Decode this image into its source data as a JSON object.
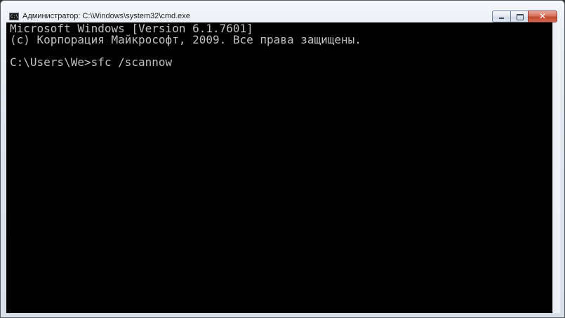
{
  "window": {
    "title": "Администратор: C:\\Windows\\system32\\cmd.exe",
    "icon": "cmd-icon",
    "icon_text": "C:\\"
  },
  "controls": {
    "minimize": "minimize-icon",
    "maximize": "maximize-icon",
    "close": "close-icon",
    "close_glyph": "✕"
  },
  "console": {
    "lines": [
      "Microsoft Windows [Version 6.1.7601]",
      "(c) Корпорация Майкрософт, 2009. Все права защищены.",
      "",
      "C:\\Users\\We>sfc /scannow"
    ],
    "background": "#000000",
    "foreground": "#c0c0c0"
  }
}
